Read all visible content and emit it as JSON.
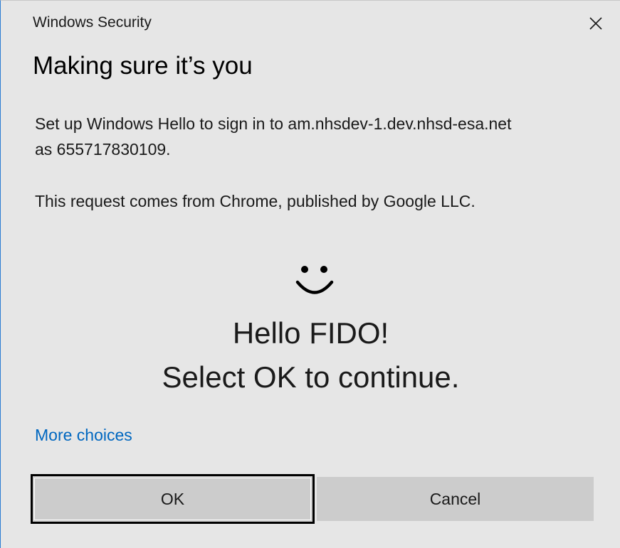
{
  "window": {
    "title": "Windows Security",
    "close_icon": "close-icon"
  },
  "heading": "Making sure it’s you",
  "description": {
    "line1": "Set up Windows Hello to sign in to am.nhsdev-1.dev.nhsd-esa.net",
    "line2": "as 655717830109.",
    "line3": "This request comes from Chrome, published by Google LLC."
  },
  "hello": {
    "icon": "smiley-face-icon",
    "line1": "Hello FIDO!",
    "line2": "Select OK to continue."
  },
  "more_choices": "More choices",
  "buttons": {
    "ok": "OK",
    "cancel": "Cancel"
  },
  "colors": {
    "background": "#e6e6e6",
    "link": "#0067c0",
    "button": "#cccccc",
    "accent_border": "#2b7cd3"
  }
}
